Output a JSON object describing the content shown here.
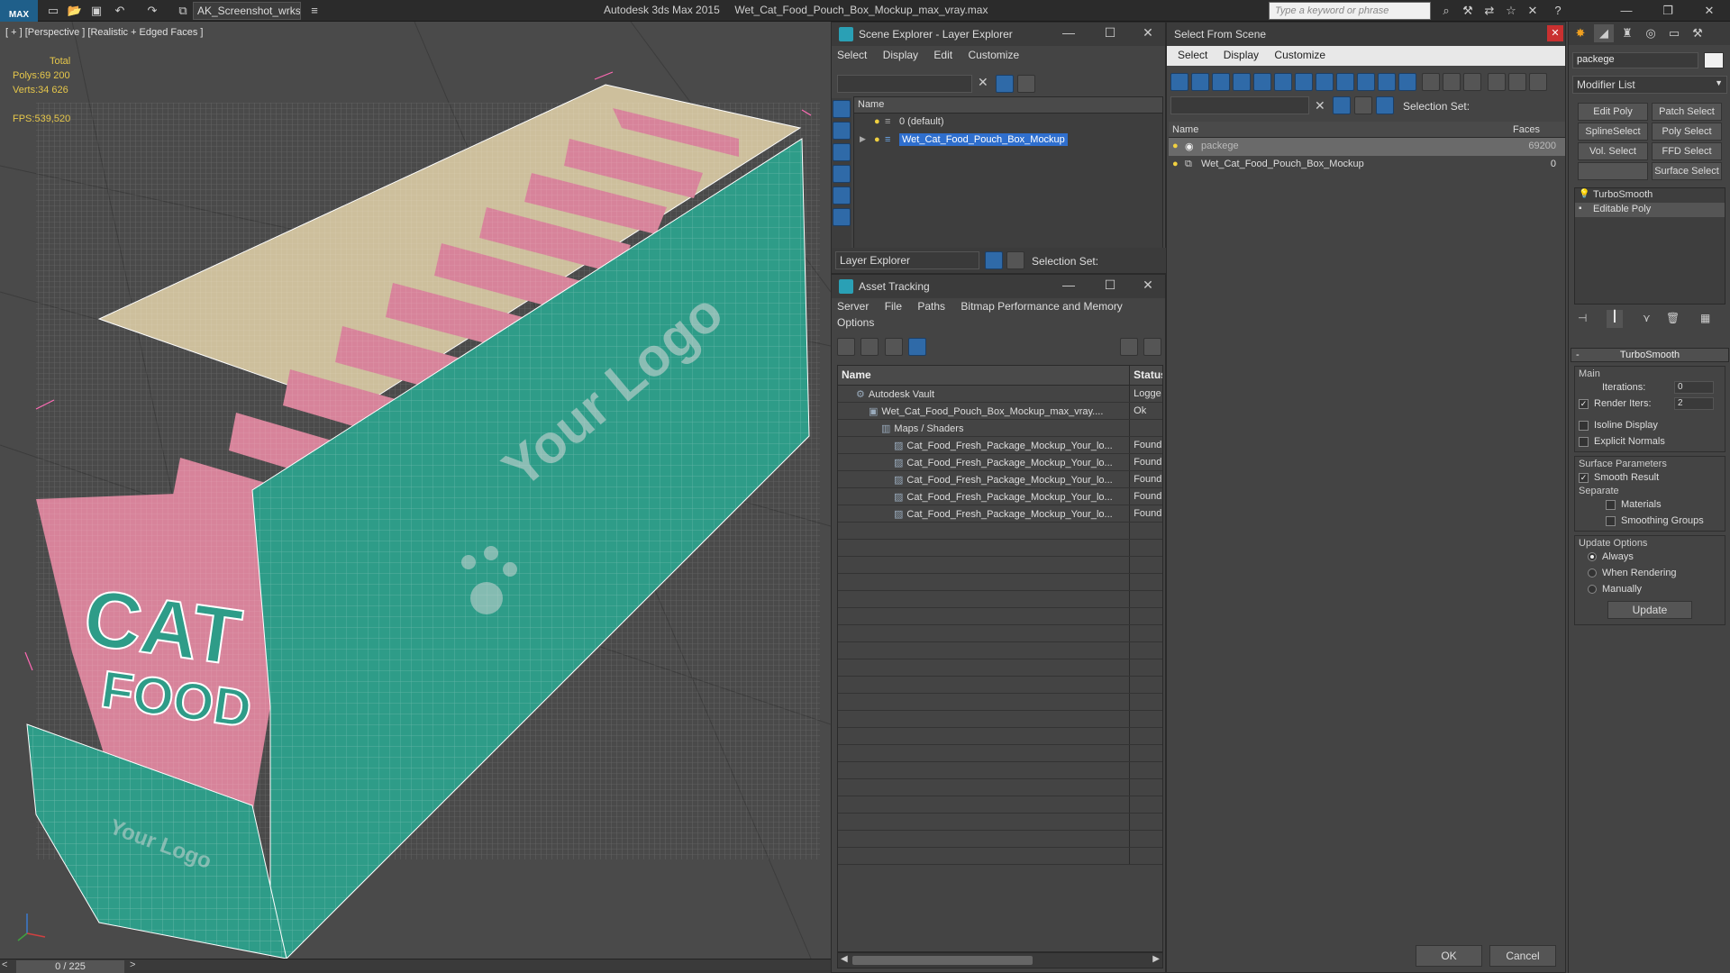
{
  "titlebar": {
    "logo_text": "MAX",
    "workspace": "AK_Screenshot_wrksp",
    "app_title": "Autodesk 3ds Max  2015",
    "file_title": "Wet_Cat_Food_Pouch_Box_Mockup_max_vray.max",
    "search_placeholder": "Type a keyword or phrase"
  },
  "viewport": {
    "label": "[ + ] [Perspective ] [Realistic + Edged Faces ]",
    "stats": {
      "total_label": "Total",
      "polys_label": "Polys:",
      "polys_value": "69 200",
      "verts_label": "Verts:",
      "verts_value": "34 626",
      "fps_label": "FPS:",
      "fps_value": "539,520"
    },
    "model_text": {
      "logo": "Your Logo",
      "product_line1": "CAT",
      "product_line2": "FOOD",
      "small_logo": "Your Logo"
    },
    "colors": {
      "box": "#2e9c88",
      "pouch": "#d7839a",
      "background": "#4a4a4a"
    }
  },
  "timeline": {
    "frame_label": "0 / 225"
  },
  "scene_explorer": {
    "title": "Scene Explorer - Layer Explorer",
    "menu": [
      "Select",
      "Display",
      "Edit",
      "Customize"
    ],
    "column_name": "Name",
    "rows": [
      {
        "label": "0 (default)",
        "selected": false
      },
      {
        "label": "Wet_Cat_Food_Pouch_Box_Mockup",
        "selected": true
      }
    ],
    "footer_dropdown": "Layer Explorer",
    "selection_set_label": "Selection Set:"
  },
  "asset_tracking": {
    "title": "Asset Tracking",
    "menu": [
      "Server",
      "File",
      "Paths",
      "Bitmap Performance and Memory"
    ],
    "menu_row2": [
      "Options"
    ],
    "columns": {
      "name": "Name",
      "status": "Status"
    },
    "rows": [
      {
        "name": "Autodesk Vault",
        "status": "Logge",
        "indent": 1
      },
      {
        "name": "Wet_Cat_Food_Pouch_Box_Mockup_max_vray....",
        "status": "Ok",
        "indent": 2
      },
      {
        "name": "Maps / Shaders",
        "status": "",
        "indent": 3
      },
      {
        "name": "Cat_Food_Fresh_Package_Mockup_Your_lo...",
        "status": "Found",
        "indent": 4
      },
      {
        "name": "Cat_Food_Fresh_Package_Mockup_Your_lo...",
        "status": "Found",
        "indent": 4
      },
      {
        "name": "Cat_Food_Fresh_Package_Mockup_Your_lo...",
        "status": "Found",
        "indent": 4
      },
      {
        "name": "Cat_Food_Fresh_Package_Mockup_Your_lo...",
        "status": "Found",
        "indent": 4
      },
      {
        "name": "Cat_Food_Fresh_Package_Mockup_Your_lo...",
        "status": "Found",
        "indent": 4
      }
    ]
  },
  "select_from_scene": {
    "title": "Select From Scene",
    "menu": [
      "Select",
      "Display",
      "Customize"
    ],
    "selection_set_label": "Selection Set:",
    "columns": {
      "name": "Name",
      "faces": "Faces"
    },
    "rows": [
      {
        "name": "packege",
        "faces": "69200",
        "selected": true
      },
      {
        "name": "Wet_Cat_Food_Pouch_Box_Mockup",
        "faces": "0",
        "selected": false
      }
    ],
    "ok_label": "OK",
    "cancel_label": "Cancel"
  },
  "command_panel": {
    "object_name": "packege",
    "modifier_list": "Modifier List",
    "buttons": [
      "Edit Poly",
      "Patch Select",
      "SplineSelect",
      "Poly Select",
      "Vol. Select",
      "FFD Select",
      "",
      "Surface Select"
    ],
    "stack": [
      "TurboSmooth",
      "Editable Poly"
    ],
    "rollout_title": "TurboSmooth",
    "main_label": "Main",
    "iterations_label": "Iterations:",
    "iterations_value": "0",
    "render_iters_label": "Render Iters:",
    "render_iters_value": "2",
    "isoline_label": "Isoline Display",
    "explicit_normals_label": "Explicit Normals",
    "surface_params_label": "Surface Parameters",
    "smooth_result_label": "Smooth Result",
    "separate_label": "Separate",
    "materials_label": "Materials",
    "smoothing_groups_label": "Smoothing Groups",
    "update_options_label": "Update Options",
    "always_label": "Always",
    "when_rendering_label": "When Rendering",
    "manually_label": "Manually",
    "update_button": "Update"
  }
}
